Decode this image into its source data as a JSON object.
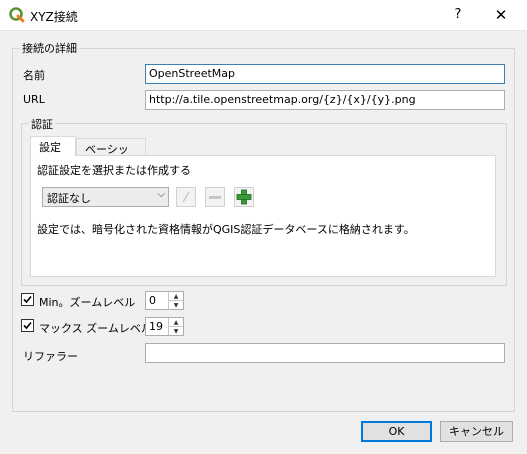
{
  "window": {
    "title": "XYZ接続",
    "help_label": "?",
    "close_label": "✕",
    "app_icon": "qgis-logo-icon"
  },
  "details_group": {
    "title": "接続の詳細",
    "name_label": "名前",
    "name_value": "OpenStreetMap",
    "url_label": "URL",
    "url_value": "http://a.tile.openstreetmap.org/{z}/{x}/{y}.png"
  },
  "auth_group": {
    "title": "認証",
    "tabs": [
      {
        "label": "設定",
        "active": true
      },
      {
        "label": "ベーシック",
        "active": false
      }
    ],
    "select_label": "認証設定を選択または作成する",
    "auth_select_value": "認証なし",
    "auth_select_arrow": "⌵",
    "edit_icon": "pencil-icon",
    "remove_icon": "minus-icon",
    "add_icon": "plus-icon",
    "info_text": "設定では、暗号化された資格情報がQGIS認証データベースに格納されます。"
  },
  "zoom": {
    "min_label": "Min。ズームレベル",
    "min_checked": true,
    "min_value": "0",
    "max_label": "マックス ズームレベル",
    "max_checked": true,
    "max_value": "19"
  },
  "referer": {
    "label": "リファラー",
    "value": ""
  },
  "buttons": {
    "ok_label": "OK",
    "cancel_label": "キャンセル"
  },
  "colors": {
    "accent": "#0078d7",
    "add_icon_green": "#3a9a3a",
    "qgis_green": "#589632"
  }
}
